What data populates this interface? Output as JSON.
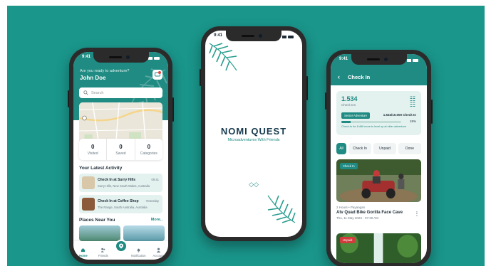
{
  "colors": {
    "background": "#1a968b",
    "brand": "#1f8b82",
    "dark": "#1d2b36",
    "unpaid": "#d23c3c"
  },
  "phone_home": {
    "status_time": "9:41",
    "greeting": "Are you ready to adventure?",
    "user_name": "John Doe",
    "search_placeholder": "Search",
    "stats": [
      {
        "value": "0",
        "label": "Visited"
      },
      {
        "value": "0",
        "label": "Saved"
      },
      {
        "value": "0",
        "label": "Categories"
      }
    ],
    "latest_activity_title": "Your Latest Activity",
    "activities": [
      {
        "title": "Check In at Surry Hills",
        "subtitle": "Surry Hills, New South Wales, Australia",
        "time": "09:41"
      },
      {
        "title": "Check In at Coffee Shop",
        "subtitle": "The Range, South Australia, Australia",
        "time": "Yesterday"
      }
    ],
    "places_title": "Places Near You",
    "more_label": "More..",
    "tabs": [
      {
        "label": "Home",
        "icon": "home-icon",
        "active": true
      },
      {
        "label": "Friends",
        "icon": "friends-icon",
        "active": false
      },
      {
        "label": "Notification",
        "icon": "bell-icon",
        "active": false
      },
      {
        "label": "Account",
        "icon": "account-icon",
        "active": false
      }
    ]
  },
  "phone_splash": {
    "status_time": "9:41",
    "logo": "NOMI QUEST",
    "tagline": "Microadventures With Friends"
  },
  "phone_checkin": {
    "status_time": "9:41",
    "title": "Check In",
    "checkin_count": "1.534",
    "checkin_label": "Check Ins",
    "level_badge": "Senior Adventure",
    "progress_text": "1.534/10.000 Check In",
    "progress_percent": "15%",
    "progress_value": 15,
    "progress_note": "Check-In for 8.466 more to level up at elder adventure",
    "filters": [
      "All",
      "Check In",
      "Unpaid",
      "Done"
    ],
    "active_filter": "All",
    "trips": [
      {
        "tag": "Check In",
        "meta": "2 Hours • Payangan",
        "title": "Atv Quad Bike Gorilla Face Cave",
        "date": "Thu, 11 May 2023 - 07:30 AM"
      },
      {
        "tag": "Unpaid"
      }
    ]
  }
}
